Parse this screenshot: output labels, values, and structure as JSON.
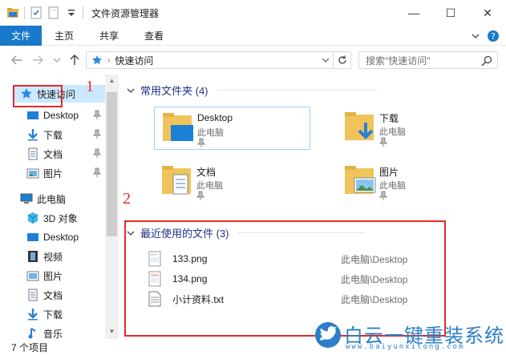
{
  "window": {
    "title": "文件资源管理器",
    "controls": {
      "minimize": "—",
      "maximize": "☐",
      "close": "✕"
    }
  },
  "ribbon": {
    "tabs": [
      "文件",
      "主页",
      "共享",
      "查看"
    ]
  },
  "address": {
    "crumb": "快速访问",
    "search_placeholder": "搜索\"快速访问\""
  },
  "nav": {
    "quick_access": "快速访问",
    "quick_items": [
      "Desktop",
      "下载",
      "文档",
      "图片"
    ],
    "this_pc": "此电脑",
    "pc_items": [
      "3D 对象",
      "Desktop",
      "视频",
      "图片",
      "文档",
      "下载",
      "音乐"
    ]
  },
  "content": {
    "frequent_header": "常用文件夹 (4)",
    "folders": [
      {
        "name": "Desktop",
        "location": "此电脑"
      },
      {
        "name": "下载",
        "location": "此电脑"
      },
      {
        "name": "文档",
        "location": "此电脑"
      },
      {
        "name": "图片",
        "location": "此电脑"
      }
    ],
    "recent_header": "最近使用的文件 (3)",
    "recent_files": [
      {
        "name": "133.png",
        "path": "此电脑\\Desktop"
      },
      {
        "name": "134.png",
        "path": "此电脑\\Desktop"
      },
      {
        "name": "小计资料.txt",
        "path": "此电脑\\Desktop"
      }
    ]
  },
  "annotations": {
    "num1": "1",
    "num2": "2"
  },
  "status": {
    "count": "7 个项目"
  },
  "watermark": {
    "text": "白云一键重装系统",
    "sub": "www.baiyunxitong.com"
  },
  "colors": {
    "accent": "#1979ca",
    "annotation": "#e22b2b",
    "selection": "#cce8ff",
    "link_header": "#1e3287"
  }
}
